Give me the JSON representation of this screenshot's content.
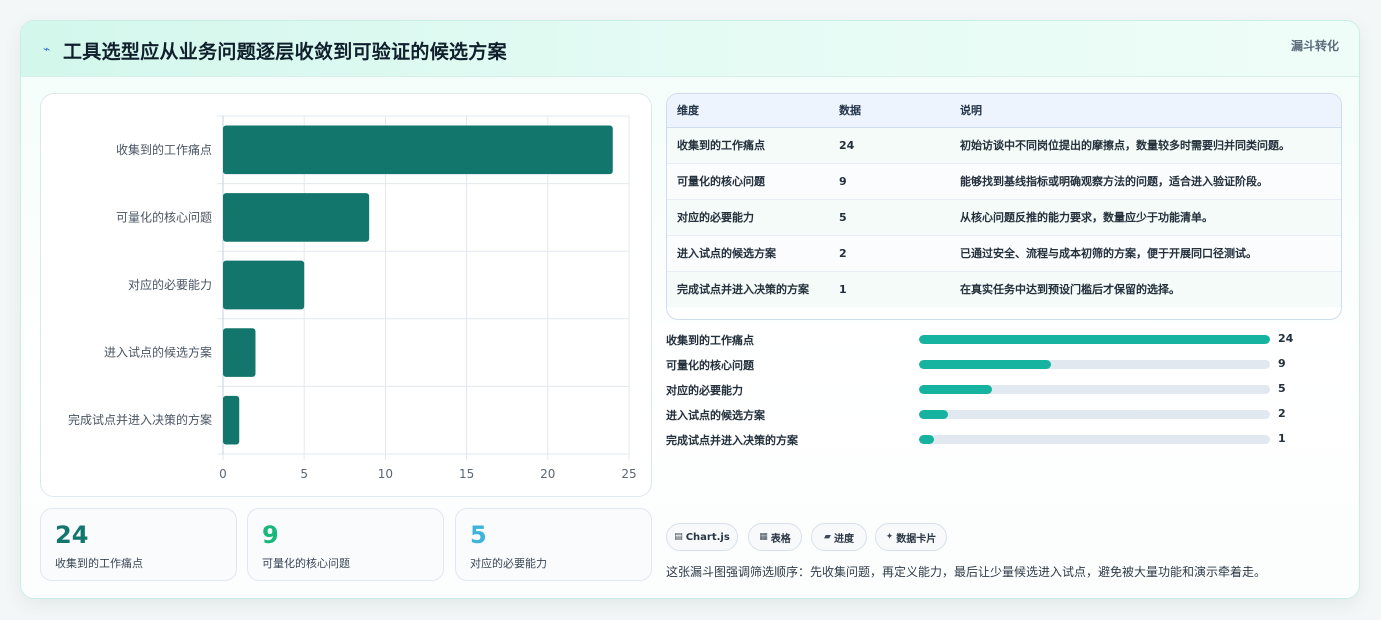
{
  "header": {
    "icon": "bolt-icon",
    "title": "工具选型应从业务问题逐层收敛到可验证的候选方案",
    "tag": "漏斗转化"
  },
  "chart_data": {
    "type": "bar",
    "orientation": "horizontal",
    "categories": [
      "收集到的工作痛点",
      "可量化的核心问题",
      "对应的必要能力",
      "进入试点的候选方案",
      "完成试点并进入决策的方案"
    ],
    "values": [
      24,
      9,
      5,
      2,
      1
    ],
    "xlim": [
      0,
      25
    ],
    "ticks": [
      "0",
      "5",
      "10",
      "15",
      "20",
      "25"
    ],
    "grid": true,
    "bar_color": "#12766c"
  },
  "kpis": [
    {
      "value": "24",
      "label": "收集到的工作痛点",
      "color": "#12766c"
    },
    {
      "value": "9",
      "label": "可量化的核心问题",
      "color": "#18b87a"
    },
    {
      "value": "5",
      "label": "对应的必要能力",
      "color": "#3fb3dc"
    }
  ],
  "table": {
    "headers": [
      "维度",
      "数据",
      "说明"
    ],
    "rows": [
      [
        "收集到的工作痛点",
        "24",
        "初始访谈中不同岗位提出的摩擦点，数量较多时需要归并同类问题。"
      ],
      [
        "可量化的核心问题",
        "9",
        "能够找到基线指标或明确观察方法的问题，适合进入验证阶段。"
      ],
      [
        "对应的必要能力",
        "5",
        "从核心问题反推的能力要求，数量应少于功能清单。"
      ],
      [
        "进入试点的候选方案",
        "2",
        "已通过安全、流程与成本初筛的方案，便于开展同口径测试。"
      ],
      [
        "完成试点并进入决策的方案",
        "1",
        "在真实任务中达到预设门槛后才保留的选择。"
      ]
    ]
  },
  "progress": {
    "max": 24,
    "items": [
      {
        "label": "收集到的工作痛点",
        "value": 24,
        "display": "24"
      },
      {
        "label": "可量化的核心问题",
        "value": 9,
        "display": "9"
      },
      {
        "label": "对应的必要能力",
        "value": 5,
        "display": "5"
      },
      {
        "label": "进入试点的候选方案",
        "value": 2,
        "display": "2"
      },
      {
        "label": "完成试点并进入决策的方案",
        "value": 1,
        "display": "1"
      }
    ]
  },
  "chips": [
    {
      "icon": "chart-icon",
      "glyph": "▤",
      "label": "Chart.js"
    },
    {
      "icon": "table-icon",
      "glyph": "▦",
      "label": "表格"
    },
    {
      "icon": "progress-icon",
      "glyph": "▰",
      "label": "进度"
    },
    {
      "icon": "sparkle-icon",
      "glyph": "✦",
      "label": "数据卡片"
    }
  ],
  "note": "这张漏斗图强调筛选顺序：先收集问题，再定义能力，最后让少量候选进入试点，避免被大量功能和演示牵着走。"
}
